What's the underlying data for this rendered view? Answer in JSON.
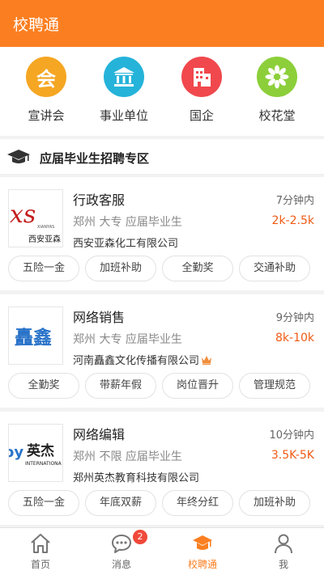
{
  "app": {
    "title": "校聘通",
    "accent": "#fb7f21",
    "salary_color": "#f05a14"
  },
  "categories": [
    {
      "label": "宣讲会",
      "icon": "hui-char-icon",
      "color": "#f5a623",
      "glyph": "会"
    },
    {
      "label": "事业单位",
      "icon": "institution-icon",
      "color": "#25b3d9"
    },
    {
      "label": "国企",
      "icon": "building-icon",
      "color": "#f0484d"
    },
    {
      "label": "校花堂",
      "icon": "flower-icon",
      "color": "#8ccf3a"
    }
  ],
  "section": {
    "title": "应届毕业生招聘专区",
    "icon": "graduation-cap-icon"
  },
  "jobs": [
    {
      "title": "行政客服",
      "time": "7分钟内",
      "meta": "郑州 大专 应届毕业生",
      "salary": "2k-2.5k",
      "company": "西安亚森化工有限公司",
      "logo": {
        "main": "西安亚森",
        "sub": "XIANYAS"
      },
      "tags": [
        "五险一金",
        "加班补助",
        "全勤奖",
        "交通补助"
      ]
    },
    {
      "title": "网络销售",
      "time": "9分钟内",
      "meta": "郑州 大专 应届毕业生",
      "salary": "8k-10k",
      "company": "河南矗鑫文化传播有限公司",
      "crown": true,
      "logo": {
        "main": "矗鑫"
      },
      "tags": [
        "全勤奖",
        "带薪年假",
        "岗位晋升",
        "管理规范"
      ]
    },
    {
      "title": "网络编辑",
      "time": "10分钟内",
      "meta": "郑州 不限 应届毕业生",
      "salary": "3.5K-5K",
      "company": "郑州英杰教育科技有限公司",
      "logo": {
        "main": "英杰",
        "sub": "INTERNATIONA"
      },
      "tags": [
        "五险一金",
        "年底双薪",
        "年终分红",
        "加班补助"
      ]
    }
  ],
  "tabbar": [
    {
      "label": "首页",
      "icon": "home-icon"
    },
    {
      "label": "消息",
      "icon": "message-icon",
      "badge": "2"
    },
    {
      "label": "校聘通",
      "icon": "graduation-cap-icon",
      "active": true
    },
    {
      "label": "我",
      "icon": "user-icon"
    }
  ]
}
